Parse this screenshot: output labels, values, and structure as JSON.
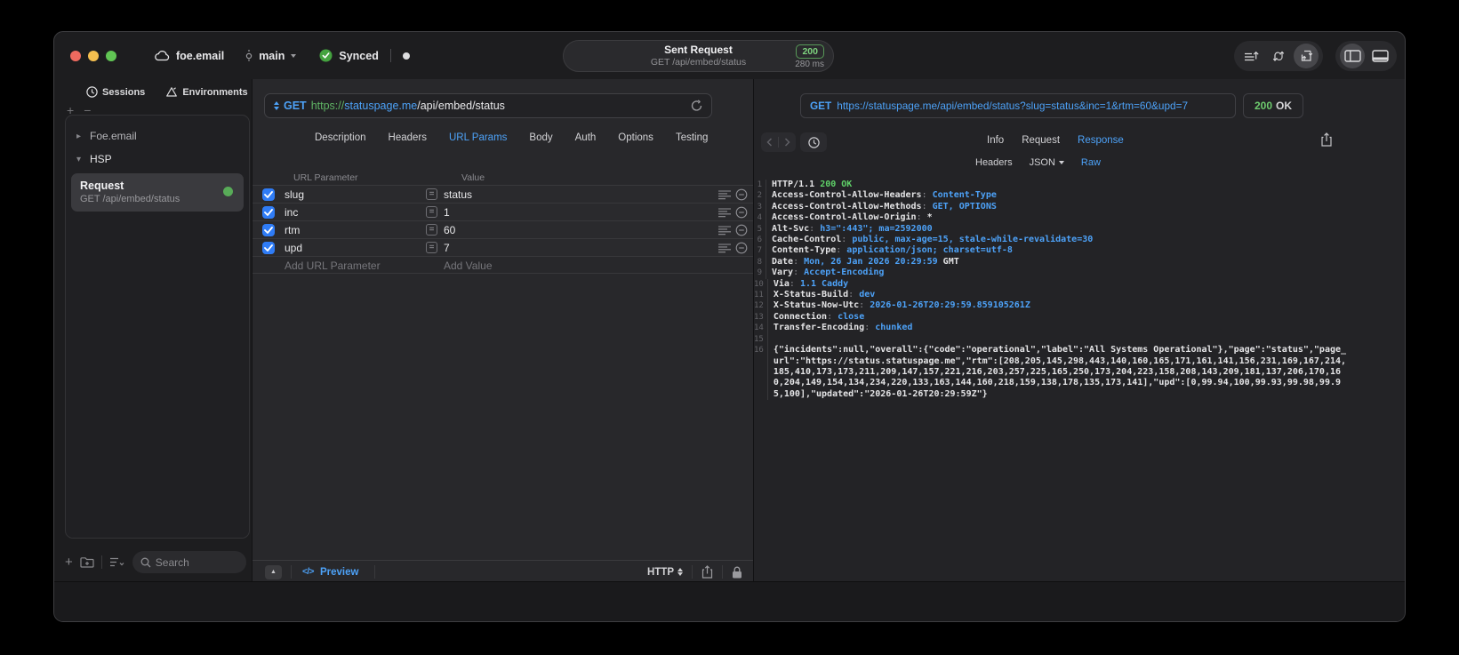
{
  "colors": {
    "accent_blue": "#4da2f8",
    "success_green": "#63c764",
    "url_scheme_green": "#5fb364",
    "checkbox_blue": "#2f7cf6",
    "traffic_close": "#ee6a5f",
    "traffic_minimize": "#f5bf4f",
    "traffic_zoom": "#61c554"
  },
  "titlebar": {
    "project_name": "foe.email",
    "branch_name": "main",
    "sync_label": "Synced",
    "request_summary": {
      "title": "Sent Request",
      "subtitle": "GET /api/embed/status",
      "status_code": "200",
      "duration": "280 ms"
    }
  },
  "sidebar": {
    "tabs": [
      {
        "label": "Sessions"
      },
      {
        "label": "Environments"
      }
    ],
    "tree": [
      {
        "label": "Foe.email"
      },
      {
        "label": "HSP"
      }
    ],
    "request_item": {
      "title": "Request",
      "subtitle": "GET /api/embed/status"
    },
    "search_placeholder": "Search"
  },
  "request_panel": {
    "method": "GET",
    "url": {
      "scheme": "https://",
      "host": "statuspage.me",
      "path": "/api/embed/status"
    },
    "tabs": [
      "Description",
      "Headers",
      "URL Params",
      "Body",
      "Auth",
      "Options",
      "Testing"
    ],
    "active_tab": "URL Params",
    "param_table": {
      "columns": [
        "URL Parameter",
        "Value"
      ],
      "rows": [
        {
          "name": "slug",
          "value": "status",
          "enabled": true
        },
        {
          "name": "inc",
          "value": "1",
          "enabled": true
        },
        {
          "name": "rtm",
          "value": "60",
          "enabled": true
        },
        {
          "name": "upd",
          "value": "7",
          "enabled": true
        }
      ],
      "add_param_placeholder": "Add URL Parameter",
      "add_value_placeholder": "Add Value"
    },
    "footer": {
      "preview_label": "Preview",
      "protocol": "HTTP"
    }
  },
  "response_panel": {
    "request_line": {
      "method": "GET",
      "url": "https://statuspage.me/api/embed/status?slug=status&inc=1&rtm=60&upd=7"
    },
    "status_code": "200",
    "status_text": "OK",
    "tabs": [
      "Info",
      "Request",
      "Response"
    ],
    "active_tab": "Response",
    "subtabs": [
      "Headers",
      "JSON",
      "Raw"
    ],
    "active_subtab": "Raw",
    "http_status_line": {
      "protocol": "HTTP/1.1",
      "status": "200 OK"
    },
    "headers": [
      {
        "name": "Access-Control-Allow-Headers",
        "value": "Content-Type"
      },
      {
        "name": "Access-Control-Allow-Methods",
        "value": "GET, OPTIONS"
      },
      {
        "name": "Access-Control-Allow-Origin",
        "value": "*",
        "plain": true
      },
      {
        "name": "Alt-Svc",
        "value": "h3=\":443\"; ma=2592000"
      },
      {
        "name": "Cache-Control",
        "value": "public, max-age=15, stale-while-revalidate=30"
      },
      {
        "name": "Content-Type",
        "value": "application/json; charset=utf-8"
      },
      {
        "name": "Date",
        "value": "Mon, 26 Jan 2026 20:29:59",
        "suffix": "GMT"
      },
      {
        "name": "Vary",
        "value": "Accept-Encoding"
      },
      {
        "name": "Via",
        "value": "1.1 Caddy"
      },
      {
        "name": "X-Status-Build",
        "value": "dev"
      },
      {
        "name": "X-Status-Now-Utc",
        "value": "2026-01-26T20:29:59.859105261Z"
      },
      {
        "name": "Connection",
        "value": "close"
      },
      {
        "name": "Transfer-Encoding",
        "value": "chunked"
      }
    ],
    "body": "{\"incidents\":null,\"overall\":{\"code\":\"operational\",\"label\":\"All Systems Operational\"},\"page\":\"status\",\"page_url\":\"https://status.statuspage.me\",\"rtm\":[208,205,145,298,443,140,160,165,171,161,141,156,231,169,167,214,185,410,173,173,211,209,147,157,221,216,203,257,225,165,250,173,204,223,158,208,143,209,181,137,206,170,160,204,149,154,134,234,220,133,163,144,160,218,159,138,178,135,173,141],\"upd\":[0,99.94,100,99.93,99.98,99.95,100],\"updated\":\"2026-01-26T20:29:59Z\"}"
  }
}
